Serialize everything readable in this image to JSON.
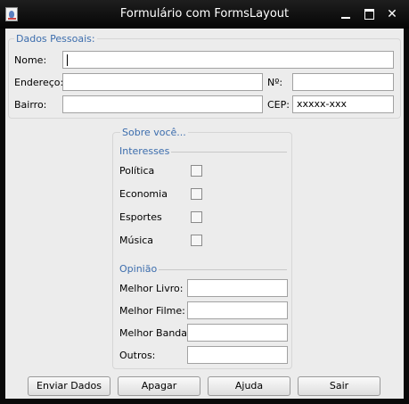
{
  "window": {
    "title": "Formulário com FormsLayout"
  },
  "pessoais": {
    "title": "Dados Pessoais:",
    "nome_label": "Nome:",
    "nome_value": "",
    "endereco_label": "Endereço:",
    "endereco_value": "",
    "numero_label": "Nº:",
    "numero_value": "",
    "bairro_label": "Bairro:",
    "bairro_value": "",
    "cep_label": "CEP:",
    "cep_value": "xxxxx-xxx"
  },
  "sobre": {
    "title": "Sobre você...",
    "interesses_label": "Interesses",
    "interesses": [
      {
        "label": "Política",
        "checked": false
      },
      {
        "label": "Economia",
        "checked": false
      },
      {
        "label": "Esportes",
        "checked": false
      },
      {
        "label": "Música",
        "checked": false
      }
    ],
    "opiniao_label": "Opinião",
    "opiniao": [
      {
        "label": "Melhor Livro:",
        "value": ""
      },
      {
        "label": "Melhor Filme:",
        "value": ""
      },
      {
        "label": "Melhor Banda:",
        "value": ""
      },
      {
        "label": "Outros:",
        "value": ""
      }
    ]
  },
  "buttons": {
    "enviar": "Enviar Dados",
    "apagar": "Apagar",
    "ajuda": "Ajuda",
    "sair": "Sair"
  },
  "titlebar_buttons": {
    "close": "✕"
  }
}
